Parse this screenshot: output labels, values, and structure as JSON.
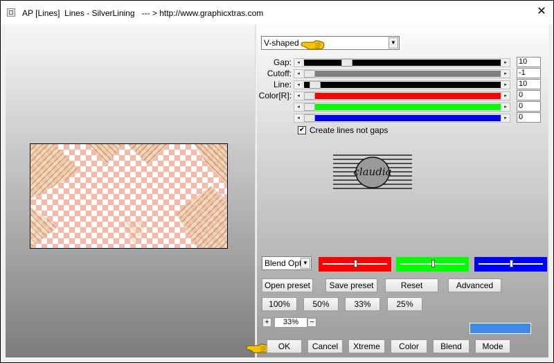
{
  "window": {
    "title": "AP [Lines]  Lines - SilverLining   --- > http://www.graphicxtras.com",
    "close_glyph": "✕"
  },
  "mode_select": {
    "value": "V-shaped"
  },
  "sliders": [
    {
      "label": "Gap:",
      "value": "10",
      "color": "#000000",
      "fill": 0.2
    },
    {
      "label": "Cutoff:",
      "value": "-1",
      "color": "#808080",
      "fill": 0.0
    },
    {
      "label": "Line:",
      "value": "10",
      "color": "#000000",
      "fill": 0.03
    },
    {
      "label": "Color[R]:",
      "value": "0",
      "color": "#ff0000",
      "fill": 0.0
    },
    {
      "label": "",
      "value": "0",
      "color": "#00ff00",
      "fill": 0.0
    },
    {
      "label": "",
      "value": "0",
      "color": "#0000ff",
      "fill": 0.0
    }
  ],
  "checkbox": {
    "label": "Create lines not gaps",
    "checked": true,
    "mark": "✔"
  },
  "logo": {
    "text": "claudia"
  },
  "blend": {
    "select_value": "Blend Optio",
    "bars": [
      {
        "color": "#ff0000",
        "level": 0.5
      },
      {
        "color": "#00ff00",
        "level": 0.5
      },
      {
        "color": "#0000ff",
        "level": 0.5
      }
    ]
  },
  "preset_buttons": {
    "open": "Open preset",
    "save": "Save preset",
    "reset": "Reset",
    "advanced": "Advanced"
  },
  "zoom_buttons": [
    "100%",
    "50%",
    "33%",
    "25%"
  ],
  "zoom": {
    "plus": "+",
    "value": "33%",
    "minus": "−"
  },
  "swatch_color": "#3c8ae8",
  "bottom_buttons": {
    "ok": "OK",
    "cancel": "Cancel",
    "xtreme": "Xtreme",
    "color": "Color",
    "blend": "Blend",
    "mode": "Mode"
  },
  "colors": {
    "pointer": "#f5c400",
    "preview_pink": "#f8b8aa"
  },
  "icons": {
    "arrow_left": "◂",
    "arrow_right": "▸",
    "dropdown": "▼"
  }
}
